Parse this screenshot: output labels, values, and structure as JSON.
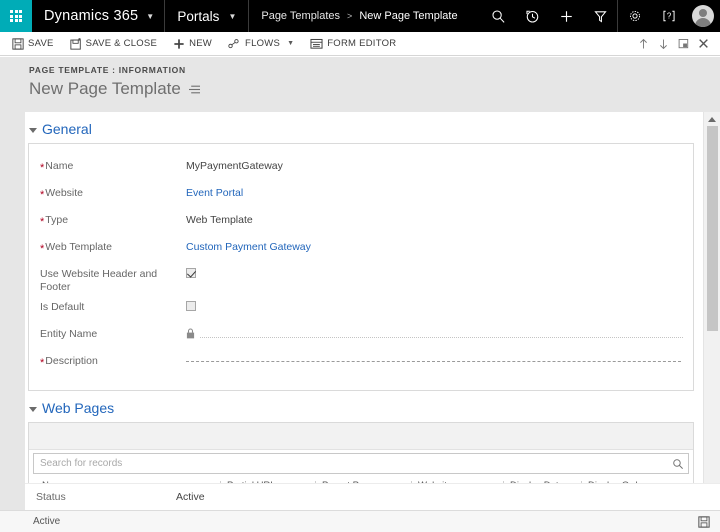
{
  "navbar": {
    "waffle_label": "App launcher",
    "app_name": "Dynamics 365",
    "area_name": "Portals",
    "breadcrumb": {
      "parent": "Page Templates",
      "separator": ">",
      "current": "New Page Template"
    },
    "icons": {
      "search": "search-icon",
      "recent": "recent-history-icon",
      "new": "quick-create-plus-icon",
      "filter": "advanced-find-filter-icon",
      "settings": "gear-settings-icon",
      "help": "help-question-icon",
      "user": "user-avatar"
    }
  },
  "commandbar": {
    "save": "SAVE",
    "save_and_close": "SAVE & CLOSE",
    "new": "NEW",
    "flows": "FLOWS",
    "form_editor": "FORM EDITOR",
    "right_icons": {
      "up": "previous-record-up-arrow-icon",
      "down": "next-record-down-arrow-icon",
      "popout": "pop-out-window-icon",
      "close": "close-x-icon"
    }
  },
  "page_header": {
    "eyebrow": "PAGE TEMPLATE : INFORMATION",
    "title": "New Page Template",
    "title_menu_icon": "record-set-menu-icon"
  },
  "general_section": {
    "heading": "General",
    "fields": [
      {
        "label": "Name",
        "required": true,
        "value": "MyPaymentGateway",
        "kind": "text"
      },
      {
        "label": "Website",
        "required": true,
        "value": "Event Portal",
        "kind": "link"
      },
      {
        "label": "Type",
        "required": true,
        "value": "Web Template",
        "kind": "text"
      },
      {
        "label": "Web Template",
        "required": true,
        "value": "Custom Payment Gateway",
        "kind": "link"
      },
      {
        "label": "Use Website Header and Footer",
        "required": false,
        "value": "",
        "kind": "checkbox",
        "checked": true
      },
      {
        "label": "Is Default",
        "required": false,
        "value": "",
        "kind": "checkbox",
        "checked": false
      },
      {
        "label": "Entity Name",
        "required": false,
        "value": "",
        "kind": "locked"
      },
      {
        "label": "Description",
        "required": true,
        "value": "",
        "kind": "dashed"
      }
    ]
  },
  "web_pages_section": {
    "heading": "Web Pages",
    "search_placeholder": "Search for records",
    "search_value": "",
    "search_icon": "search-icon",
    "columns": [
      {
        "label": "Name",
        "sort": "↑"
      },
      {
        "label": "Partial URL",
        "sort": ""
      },
      {
        "label": "Parent Page",
        "sort": ""
      },
      {
        "label": "Website",
        "sort": ""
      },
      {
        "label": "Display Date",
        "sort": ""
      },
      {
        "label": "Display Order",
        "sort": ""
      }
    ]
  },
  "footer": {
    "status_label": "Status",
    "status_value": "Active",
    "statusbar_text": "Active",
    "statusbar_icon": "save-disk-icon"
  },
  "colors": {
    "nav_background": "#000000",
    "waffle_accent": "#00ACB7",
    "link": "#2266bb",
    "required_marker": "#b00020",
    "page_background": "#e6e6e6"
  }
}
